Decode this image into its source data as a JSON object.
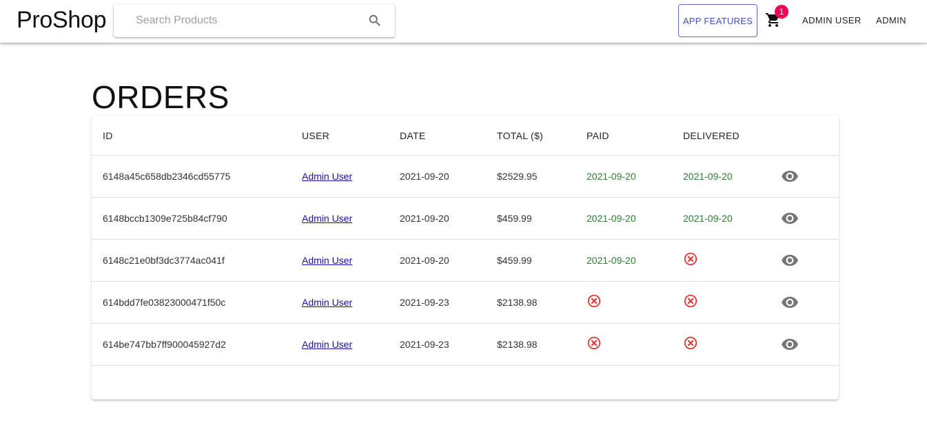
{
  "header": {
    "brand": "ProShop",
    "search_placeholder": "Search Products",
    "features_label": "APP FEATURES",
    "cart_count": "1",
    "user_label": "ADMIN USER",
    "admin_label": "ADMIN"
  },
  "page": {
    "title": "ORDERS"
  },
  "table": {
    "columns": [
      "ID",
      "USER",
      "DATE",
      "TOTAL ($)",
      "PAID",
      "DELIVERED"
    ],
    "rows": [
      {
        "id": "6148a45c658db2346cd55775",
        "user": "Admin User",
        "date": "2021-09-20",
        "total": "$2529.95",
        "paid": "2021-09-20",
        "delivered": "2021-09-20"
      },
      {
        "id": "6148bccb1309e725b84cf790",
        "user": "Admin User",
        "date": "2021-09-20",
        "total": "$459.99",
        "paid": "2021-09-20",
        "delivered": "2021-09-20"
      },
      {
        "id": "6148c21e0bf3dc3774ac041f",
        "user": "Admin User",
        "date": "2021-09-20",
        "total": "$459.99",
        "paid": "2021-09-20",
        "delivered": null
      },
      {
        "id": "614bdd7fe03823000471f50c",
        "user": "Admin User",
        "date": "2021-09-23",
        "total": "$2138.98",
        "paid": null,
        "delivered": null
      },
      {
        "id": "614be747bb7ff900045927d2",
        "user": "Admin User",
        "date": "2021-09-23",
        "total": "$2138.98",
        "paid": null,
        "delivered": null
      }
    ]
  },
  "icons": {
    "search": "search-icon",
    "cart": "shopping-cart-icon",
    "not_done": "cancel-circle-icon",
    "view": "eye-icon"
  },
  "colors": {
    "accent": "#3f51b5",
    "badge": "#f50057",
    "paid_green": "#2e7d32",
    "cancel_red": "#e53935",
    "view_grey": "#757575"
  }
}
